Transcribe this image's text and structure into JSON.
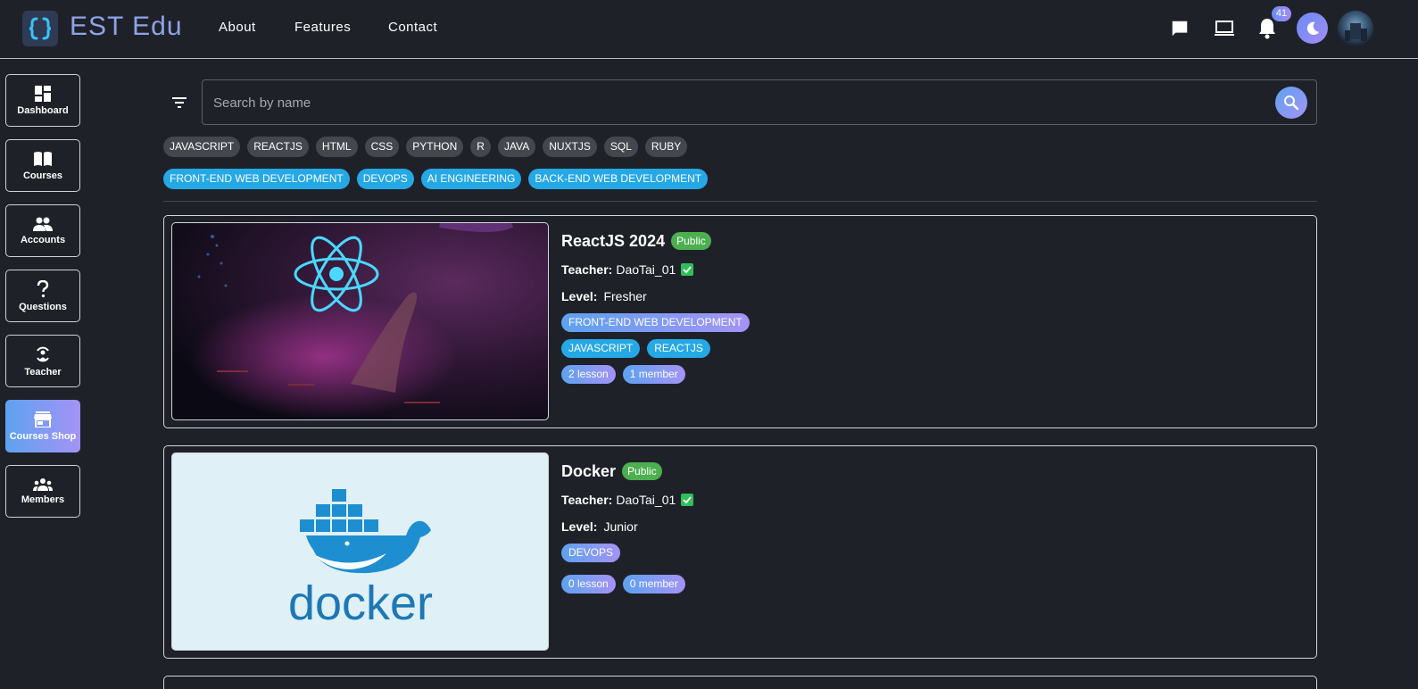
{
  "header": {
    "brand": "EST Edu",
    "nav": [
      "About",
      "Features",
      "Contact"
    ],
    "notification_count": "41"
  },
  "sidebar": {
    "items": [
      {
        "label": "Dashboard",
        "icon": "dashboard-icon"
      },
      {
        "label": "Courses",
        "icon": "book-icon"
      },
      {
        "label": "Accounts",
        "icon": "people-icon"
      },
      {
        "label": "Questions",
        "icon": "question-icon"
      },
      {
        "label": "Teacher",
        "icon": "teacher-icon"
      },
      {
        "label": "Courses Shop",
        "icon": "store-icon",
        "active": true
      },
      {
        "label": "Members",
        "icon": "group-icon"
      }
    ]
  },
  "search": {
    "placeholder": "Search by name"
  },
  "filters": {
    "languages": [
      "JAVASCRIPT",
      "REACTJS",
      "HTML",
      "CSS",
      "PYTHON",
      "R",
      "JAVA",
      "NUXTJS",
      "SQL",
      "RUBY"
    ],
    "categories": [
      "FRONT-END WEB DEVELOPMENT",
      "DEVOPS",
      "AI ENGINEERING",
      "BACK-END WEB DEVELOPMENT"
    ]
  },
  "courses": [
    {
      "title": "ReactJS 2024",
      "visibility": "Public",
      "teacher_label": "Teacher:",
      "teacher": "DaoTai_01",
      "level_label": "Level:",
      "level": "Fresher",
      "categories": [
        "FRONT-END WEB DEVELOPMENT"
      ],
      "tags": [
        "JAVASCRIPT",
        "REACTJS"
      ],
      "lessons": "2 lesson",
      "members": "1 member"
    },
    {
      "title": "Docker",
      "visibility": "Public",
      "teacher_label": "Teacher:",
      "teacher": "DaoTai_01",
      "level_label": "Level:",
      "level": "Junior",
      "categories": [
        "DEVOPS"
      ],
      "tags": [],
      "lessons": "0 lesson",
      "members": "0 member",
      "logo_text": "docker"
    }
  ],
  "colors": {
    "background": "#1f2129",
    "accent_gradient_start": "#5ea2f0",
    "accent_gradient_end": "#a493f5",
    "category_blue": "#25a8e6",
    "public_green": "#4caf50"
  }
}
